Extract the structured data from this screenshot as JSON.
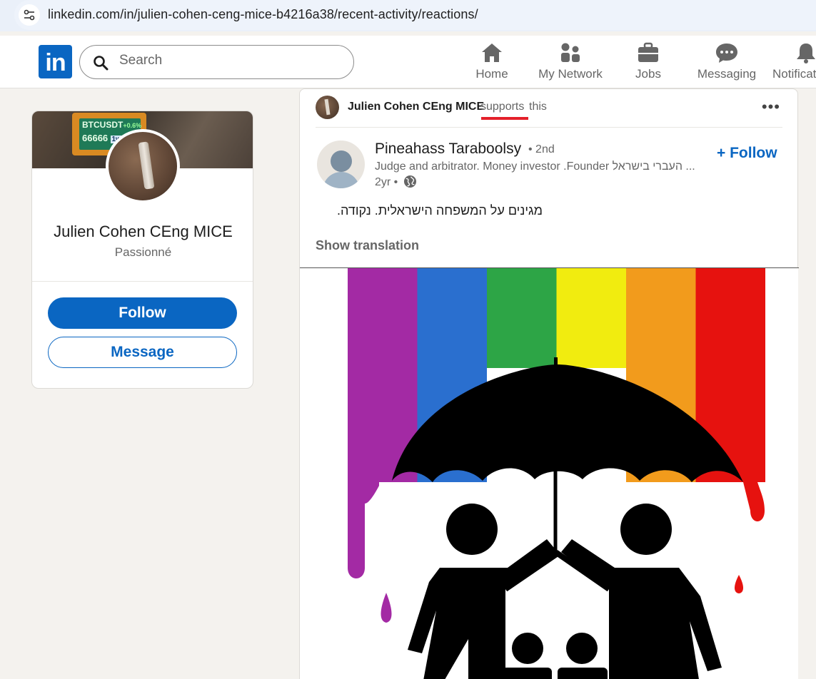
{
  "browser": {
    "url": "linkedin.com/in/julien-cohen-ceng-mice-b4216a38/recent-activity/reactions/"
  },
  "header": {
    "logo_text": "in",
    "search_placeholder": "Search",
    "nav": [
      {
        "label": "Home",
        "icon": "home-icon"
      },
      {
        "label": "My Network",
        "icon": "network-icon"
      },
      {
        "label": "Jobs",
        "icon": "briefcase-icon"
      },
      {
        "label": "Messaging",
        "icon": "messaging-icon"
      },
      {
        "label": "Notificat",
        "icon": "bell-icon"
      }
    ]
  },
  "profile": {
    "banner_ticker_symbol": "BTCUSDT",
    "banner_ticker_change": "+0.6%",
    "banner_ticker_value": "66666",
    "banner_ticker_interval": "1w",
    "name": "Julien Cohen CEng MICE",
    "headline": "Passionné",
    "follow_label": "Follow",
    "message_label": "Message"
  },
  "post": {
    "reactor_name": "Julien Cohen CEng MICE",
    "reaction_verb": "supports",
    "reaction_suffix": "this",
    "more_label": "•••",
    "author_name": "Pineahass Taraboolsy",
    "author_degree": "• 2nd",
    "author_description": "Judge and arbitrator. Money investor .Founder העברי בישראל ...",
    "post_age": "2yr •",
    "follow_label": "+ Follow",
    "text": "מגינים על המשפחה הישראלית. נקודה.",
    "show_translation": "Show translation",
    "colors": {
      "stripes": [
        "#a32aa4",
        "#2a6fcf",
        "#2da546",
        "#f1ec0f",
        "#f29b1c",
        "#e6120f"
      ],
      "accent": "#0a66c2",
      "underline": "#e4202a"
    }
  }
}
